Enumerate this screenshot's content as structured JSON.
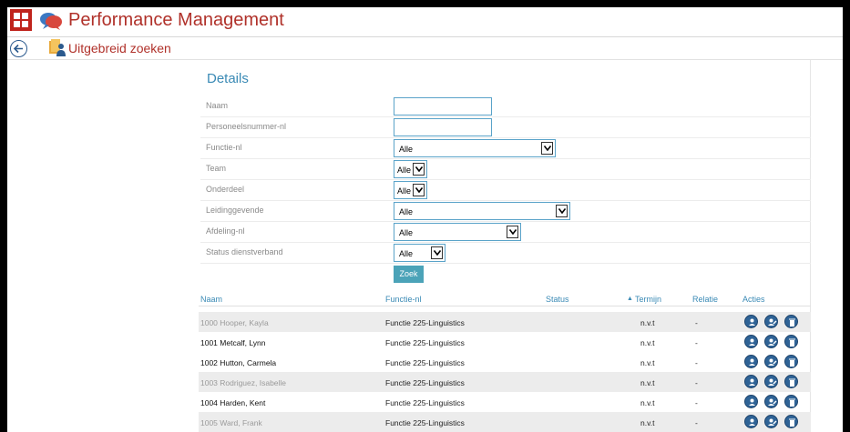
{
  "app": {
    "title": "Performance Management",
    "subtitle": "Uitgebreid zoeken"
  },
  "colors": {
    "brand": "#b0312a",
    "accent": "#3a8ab5",
    "button": "#4ba3b8"
  },
  "details": {
    "title": "Details",
    "fields": [
      {
        "label": "Naam",
        "type": "text",
        "value": ""
      },
      {
        "label": "Personeelsnummer-nl",
        "type": "text",
        "value": ""
      },
      {
        "label": "Functie-nl",
        "type": "select",
        "value": "Alle"
      },
      {
        "label": "Team",
        "type": "select",
        "value": "Alle"
      },
      {
        "label": "Onderdeel",
        "type": "select",
        "value": "Alle"
      },
      {
        "label": "Leidinggevende",
        "type": "select",
        "value": "Alle"
      },
      {
        "label": "Afdeling-nl",
        "type": "select",
        "value": "Alle"
      },
      {
        "label": "Status dienstverband",
        "type": "select",
        "value": "Alle"
      }
    ],
    "search_button": "Zoek"
  },
  "results": {
    "columns": [
      "Naam",
      "Functie-nl",
      "Status",
      "Termijn",
      "Relatie",
      "Acties"
    ],
    "sort_column": "Termijn",
    "sort_direction": "ascending",
    "rows": [
      {
        "name": "1000 Hooper, Kayla",
        "functie": "Functie 225-Linguistics",
        "status": "",
        "termijn": "n.v.t",
        "relatie": "-",
        "muted": true
      },
      {
        "name": "1001 Metcalf, Lynn",
        "functie": "Functie 225-Linguistics",
        "status": "",
        "termijn": "n.v.t",
        "relatie": "-",
        "muted": false
      },
      {
        "name": "1002 Hutton, Carmela",
        "functie": "Functie 225-Linguistics",
        "status": "",
        "termijn": "n.v.t",
        "relatie": "-",
        "muted": false
      },
      {
        "name": "1003 Rodriguez, Isabelle",
        "functie": "Functie 225-Linguistics",
        "status": "",
        "termijn": "n.v.t",
        "relatie": "-",
        "muted": true
      },
      {
        "name": "1004 Harden, Kent",
        "functie": "Functie 225-Linguistics",
        "status": "",
        "termijn": "n.v.t",
        "relatie": "-",
        "muted": false
      },
      {
        "name": "1005 Ward, Frank",
        "functie": "Functie 225-Linguistics",
        "status": "",
        "termijn": "n.v.t",
        "relatie": "-",
        "muted": true
      }
    ],
    "row_actions": [
      "employee-profile-icon",
      "employee-edit-icon",
      "delete-icon"
    ]
  }
}
